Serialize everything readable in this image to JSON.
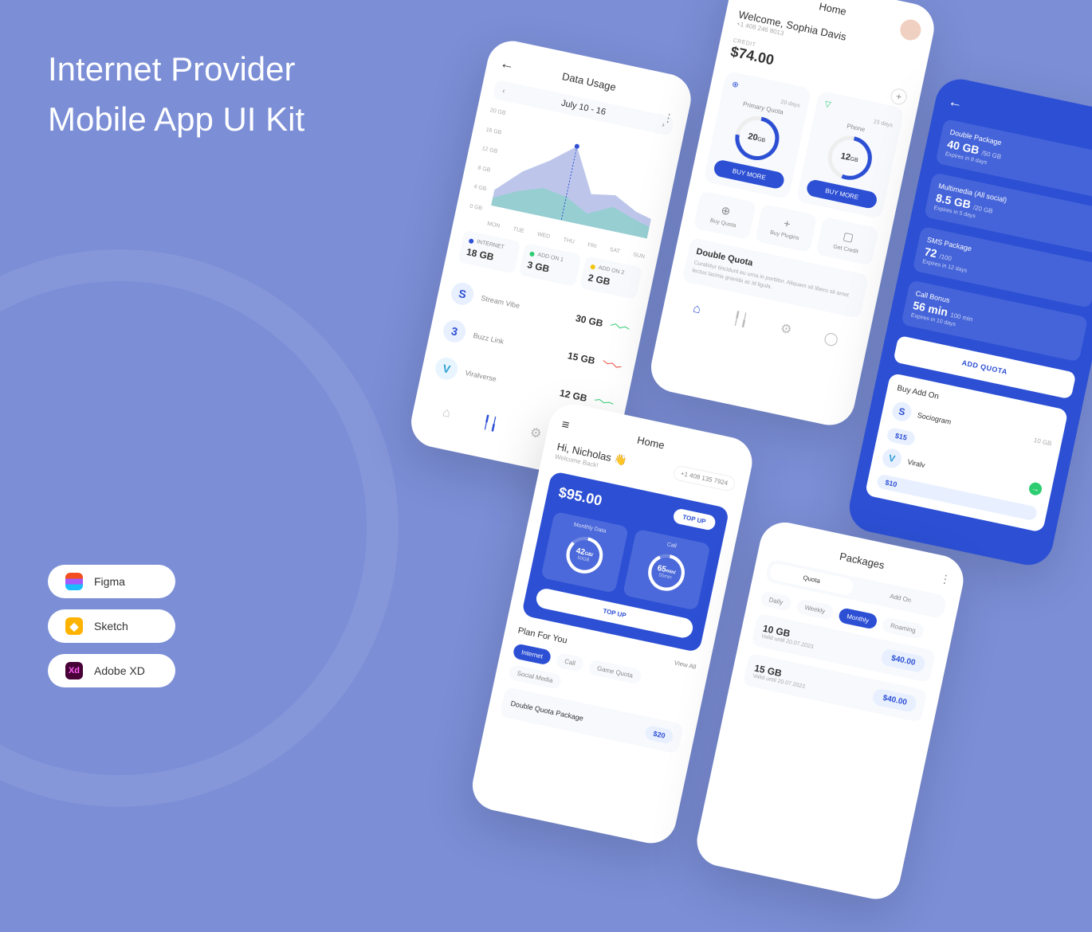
{
  "title_line1": "Internet Provider",
  "title_line2": "Mobile App UI Kit",
  "tools": {
    "figma": "Figma",
    "sketch": "Sketch",
    "xd": "Adobe XD"
  },
  "screen1": {
    "title": "Data Usage",
    "date_range": "July 10 - 16",
    "y_labels": [
      "20 GB",
      "16 GB",
      "12 GB",
      "8 GB",
      "4 GB",
      "0 GB"
    ],
    "x_labels": [
      "MON",
      "TUE",
      "WED",
      "THU",
      "FRI",
      "SAT",
      "SUN"
    ],
    "usage": [
      {
        "label": "INTERNET",
        "value": "18 GB",
        "color": "#2c4fd4"
      },
      {
        "label": "ADD ON 1",
        "value": "3 GB",
        "color": "#2ecc71"
      },
      {
        "label": "ADD ON 2",
        "value": "2 GB",
        "color": "#f1c40f"
      }
    ],
    "apps": [
      {
        "icon": "S",
        "color": "#2c4fd4",
        "name": "Stream Vibe",
        "value": "30 GB"
      },
      {
        "icon": "3",
        "color": "#2c4fd4",
        "name": "Buzz Link",
        "value": "15 GB"
      },
      {
        "icon": "V",
        "color": "#2c9fd4",
        "name": "Viralverse",
        "value": "12 GB"
      }
    ]
  },
  "screen2": {
    "nav_title": "Home",
    "welcome": "Welcome, Sophia Davis",
    "phone": "+1 408 246 8013",
    "credit_label": "CREDIT",
    "credit_value": "$74.00",
    "quotas": [
      {
        "title": "Primary Quota",
        "days": "20 days",
        "value": "20",
        "unit": "GB",
        "button": "BUY MORE"
      },
      {
        "title": "Phone",
        "days": "15 days",
        "value": "12",
        "unit": "GB",
        "button": "BUY MORE"
      }
    ],
    "actions": [
      {
        "icon": "⊕",
        "label": "Buy Quota"
      },
      {
        "icon": "+",
        "label": "Buy Plugins"
      },
      {
        "icon": "▢",
        "label": "Get Credit"
      }
    ],
    "promo_title": "Double Quota",
    "promo_desc": "Curabitur tincidunt eu urna in porttitor. Aliquam sit libero sit amet lectus lacinia gravida ac id ligula."
  },
  "screen3": {
    "packages": [
      {
        "name": "Double Package",
        "value": "40 GB",
        "of": "/50 GB",
        "expire": "Expires in 8 days"
      },
      {
        "name": "Multimedia (All social)",
        "value": "8.5 GB",
        "of": "/20 GB",
        "expire": "Expires in 5 days"
      },
      {
        "name": "SMS Package",
        "value": "72",
        "of": "/100",
        "expire": "Expires in 12 days"
      },
      {
        "name": "Call Bonus",
        "value": "56 min",
        "of": "100 min",
        "expire": "Expires in 10 days"
      }
    ],
    "add_quota_btn": "ADD QUOTA",
    "addon_title": "Buy Add On",
    "addons": [
      {
        "icon": "S",
        "name": "Sociogram",
        "gb": "10 GB",
        "price": "$15"
      },
      {
        "icon": "V",
        "name": "Viralv",
        "gb": "",
        "price": "$10"
      }
    ]
  },
  "screen4": {
    "nav_title": "Home",
    "hi": "Hi, Nicholas 👋",
    "welcome_back": "Welcome Back!",
    "phone": "+1 408 135 7924",
    "balance": "$95.00",
    "topup": "TOP UP",
    "quotas": [
      {
        "label": "Monthly Data",
        "value": "42",
        "unit": "GB/",
        "sub": "50GB"
      },
      {
        "label": "Call",
        "value": "65",
        "unit": "min/",
        "sub": "55min"
      }
    ],
    "plan_title": "Plan For You",
    "view_all": "View All",
    "tabs": [
      "Internet",
      "Call",
      "Game Quota",
      "Social Media"
    ],
    "plan_name": "Double Quota Package",
    "plan_price": "$20"
  },
  "screen5": {
    "title": "Packages",
    "tabs": [
      "Quota",
      "Add On"
    ],
    "freq": [
      "Daily",
      "Weekly",
      "Monthly",
      "Roaming"
    ],
    "items": [
      {
        "gb": "10 GB",
        "valid": "Valid until 20.07.2023",
        "price": "$40.00"
      },
      {
        "gb": "15 GB",
        "valid": "Valid until 20.07.2023",
        "price": "$40.00"
      }
    ]
  }
}
